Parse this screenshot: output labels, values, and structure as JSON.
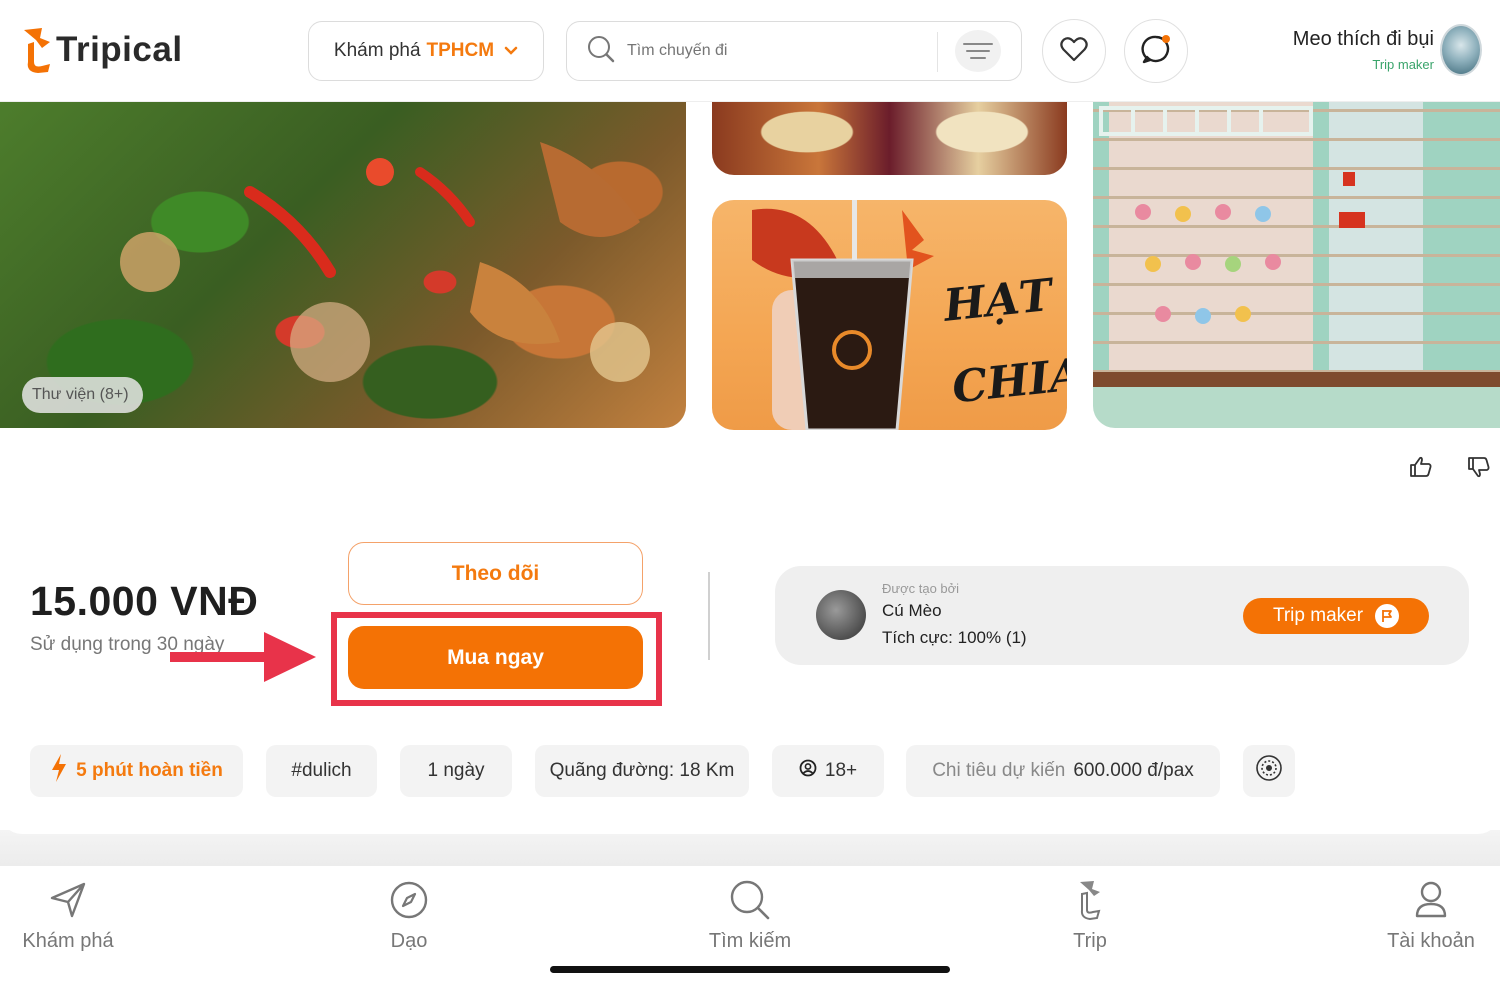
{
  "header": {
    "logo_text": "Tripical",
    "explore_label": "Khám phá",
    "explore_city": "TPHCM",
    "search_placeholder": "Tìm chuyến đi",
    "user_name": "Meo thích đi bụi",
    "user_role": "Trip maker"
  },
  "gallery": {
    "badge_label": "Thư viện (8+)",
    "drink_text": "HẠT CHIA"
  },
  "offer": {
    "price": "15.000 VNĐ",
    "usage_note": "Sử dụng trong 30 ngày",
    "follow_label": "Theo dõi",
    "buy_label": "Mua ngay"
  },
  "creator": {
    "created_by_label": "Được tạo bởi",
    "name": "Cú Mèo",
    "stats": "Tích cực: 100% (1)",
    "button_label": "Trip maker"
  },
  "tags": {
    "refund": "5 phút hoàn tiền",
    "hashtag": "#dulich",
    "duration": "1 ngày",
    "distance": "Quãng đường: 18 Km",
    "age": "18+",
    "budget_label": "Chi tiêu dự kiến",
    "budget_value": "600.000 đ/pax"
  },
  "bottom_nav": {
    "explore": "Khám phá",
    "stroll": "Dạo",
    "search": "Tìm kiếm",
    "trip": "Trip",
    "account": "Tài khoản"
  },
  "colors": {
    "accent": "#f47205",
    "highlight_red": "#e8334a",
    "creator_green": "#3aa46b"
  }
}
